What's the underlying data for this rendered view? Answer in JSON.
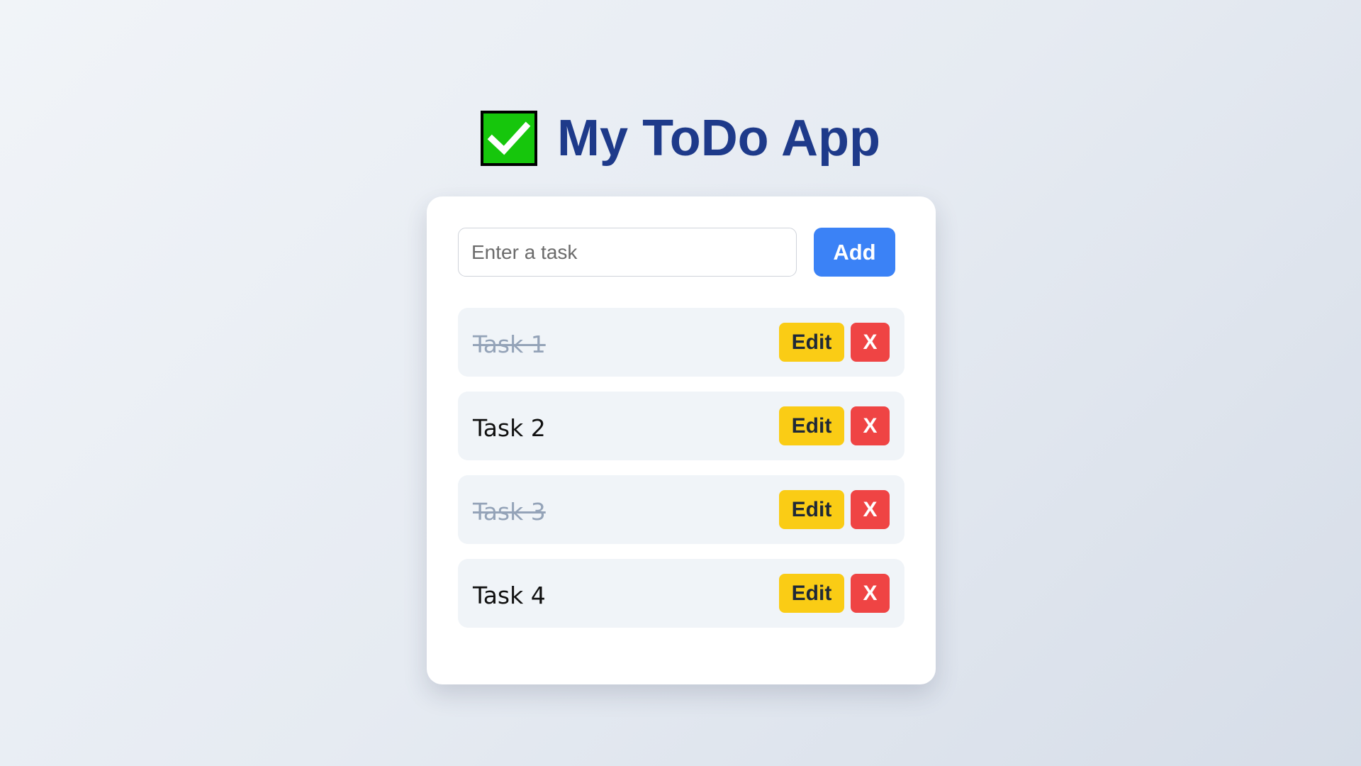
{
  "header": {
    "icon": "check-mark-button-icon",
    "title": "My ToDo App"
  },
  "input": {
    "placeholder": "Enter a task",
    "value": ""
  },
  "add_button": {
    "label": "Add"
  },
  "tasks": [
    {
      "text": "Task 1",
      "completed": true,
      "edit_label": "Edit",
      "delete_label": "X"
    },
    {
      "text": "Task 2",
      "completed": false,
      "edit_label": "Edit",
      "delete_label": "X"
    },
    {
      "text": "Task 3",
      "completed": true,
      "edit_label": "Edit",
      "delete_label": "X"
    },
    {
      "text": "Task 4",
      "completed": false,
      "edit_label": "Edit",
      "delete_label": "X"
    }
  ],
  "colors": {
    "title": "#1e3a8a",
    "add_button": "#3b82f6",
    "edit_button": "#facc15",
    "delete_button": "#ef4444",
    "check_icon": "#16c60c",
    "task_bg": "#f0f4f8",
    "completed_text": "#94a3b8"
  }
}
